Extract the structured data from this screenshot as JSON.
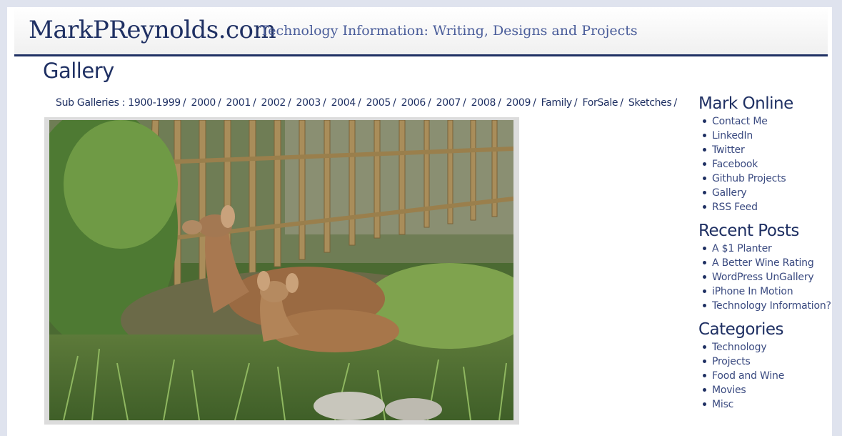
{
  "header": {
    "site_title": "MarkPReynolds.com",
    "tagline": "Technology Information:  Writing, Designs and Projects"
  },
  "page": {
    "title": "Gallery"
  },
  "subgalleries": {
    "label": "Sub Galleries :",
    "items": [
      "1900-1999",
      "2000",
      "2001",
      "2002",
      "2003",
      "2004",
      "2005",
      "2006",
      "2007",
      "2008",
      "2009",
      "Family",
      "ForSale",
      "Sketches"
    ],
    "separator": "/"
  },
  "photo": {
    "subject": "two deer resting in grass by a wooden fence"
  },
  "sidebar": {
    "mark_online": {
      "title": "Mark Online",
      "items": [
        "Contact Me",
        "LinkedIn",
        "Twitter",
        "Facebook",
        "Github Projects",
        "Gallery",
        "RSS Feed"
      ]
    },
    "recent_posts": {
      "title": "Recent Posts",
      "items": [
        "A $1 Planter",
        "A Better Wine Rating",
        "WordPress UnGallery",
        "iPhone In Motion",
        "Technology Information?"
      ]
    },
    "categories": {
      "title": "Categories",
      "items": [
        "Technology",
        "Projects",
        "Food and Wine",
        "Movies",
        "Misc"
      ]
    }
  },
  "colors": {
    "brand": "#1f3063",
    "link": "#3a4a80",
    "background": "#dfe3ee"
  }
}
